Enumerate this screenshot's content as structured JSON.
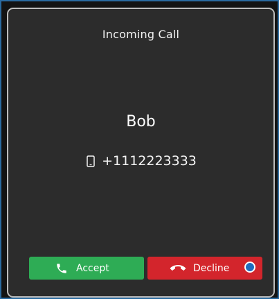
{
  "dialog": {
    "title": "Incoming Call",
    "caller_name": "Bob",
    "phone_number": "+1112223333",
    "phone_icon": "mobile-phone-icon"
  },
  "actions": {
    "accept_label": "Accept",
    "accept_icon": "phone-icon",
    "accept_color": "#2eac55",
    "decline_label": "Decline",
    "decline_icon": "hang-up-icon",
    "decline_color": "#d3252c"
  }
}
